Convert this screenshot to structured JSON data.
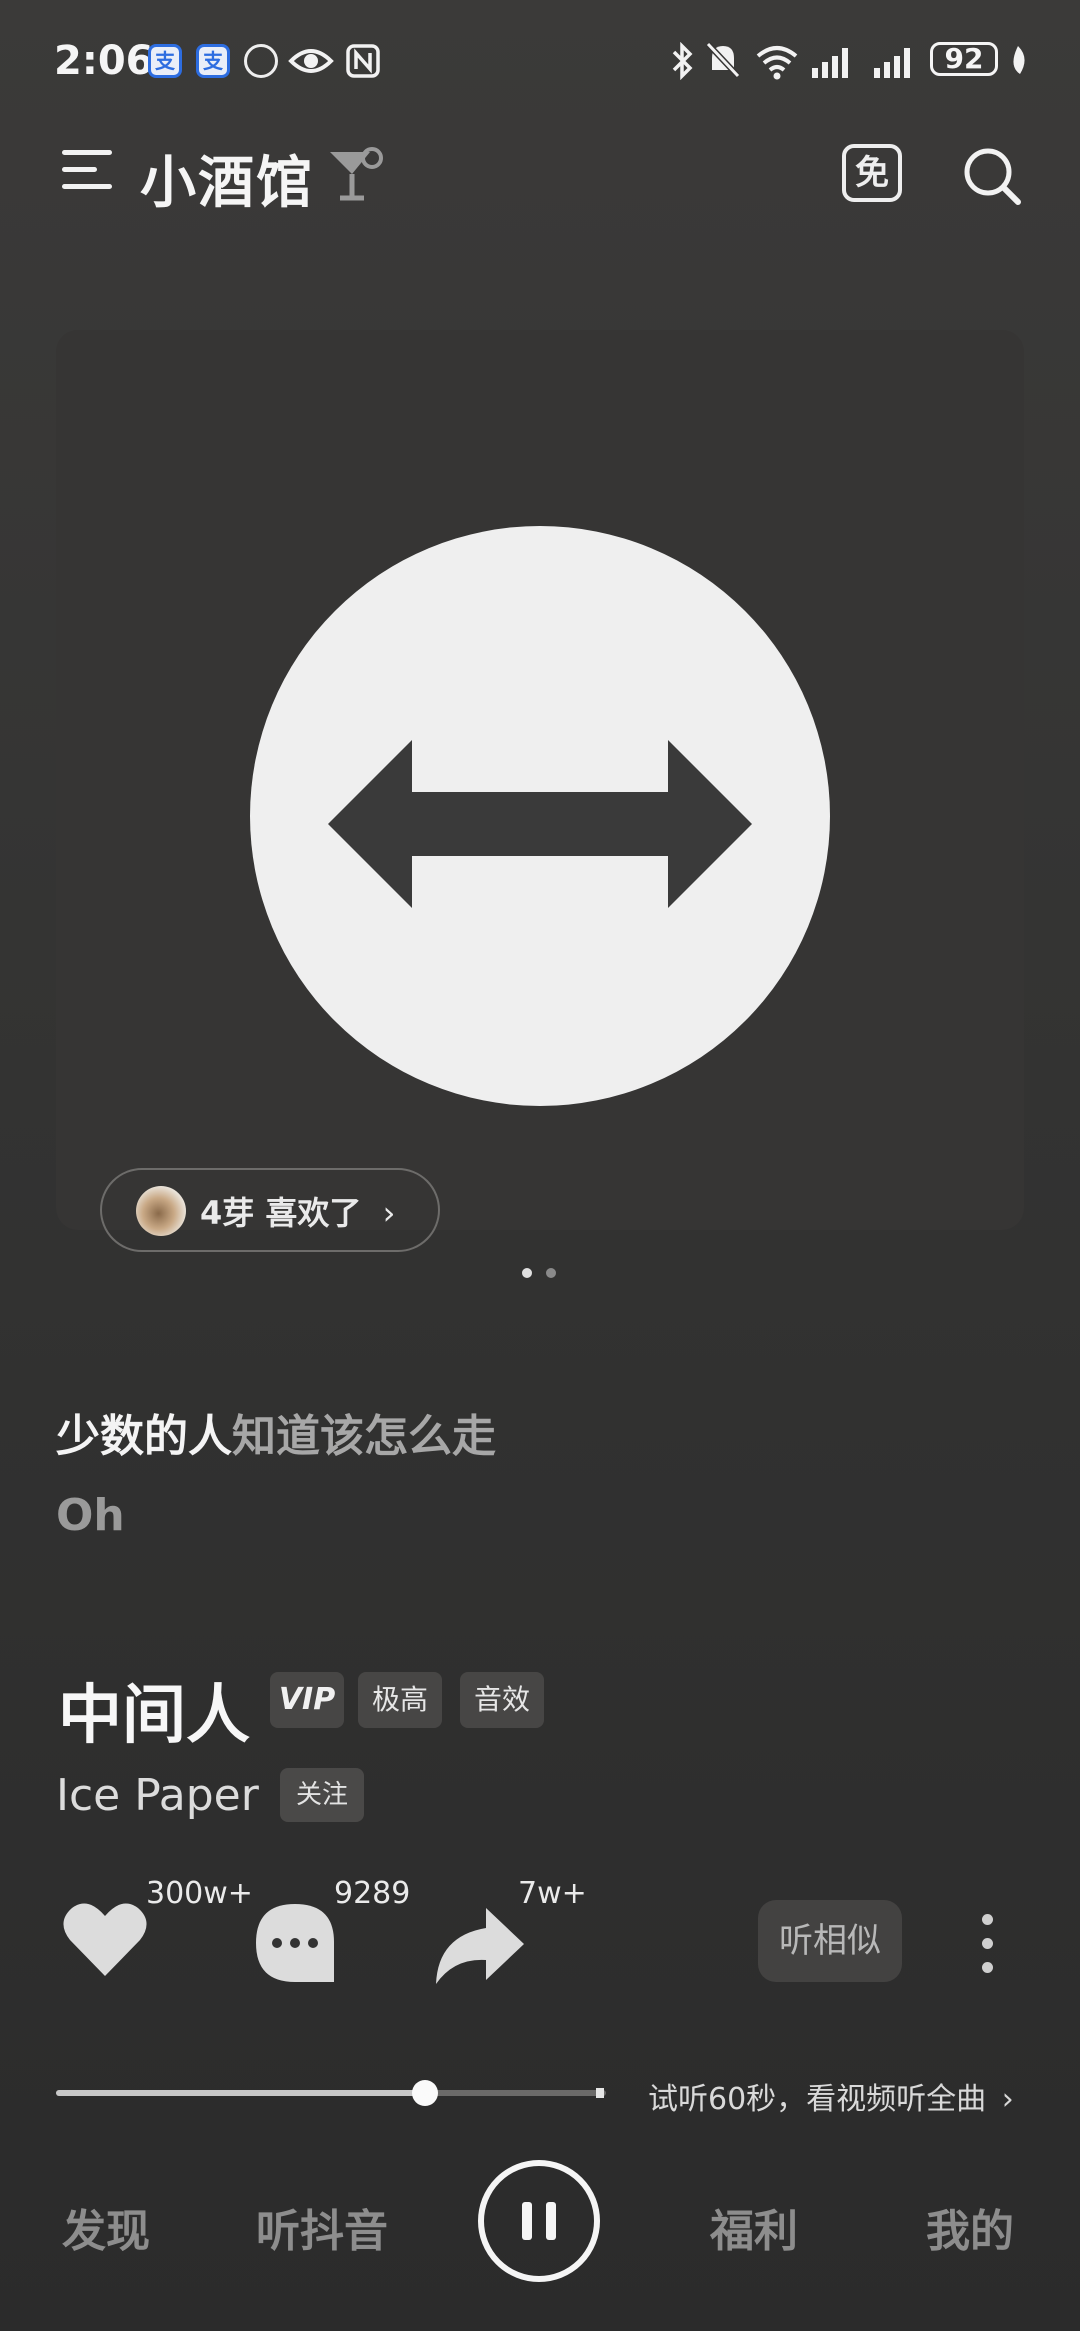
{
  "status_bar": {
    "time": "2:06",
    "battery": "92",
    "icons": [
      "alipay-icon",
      "alipay-icon",
      "app-icon",
      "eye-icon",
      "nfc-icon",
      "bluetooth-icon",
      "mute-icon",
      "wifi-icon",
      "signal-icon",
      "signal-icon",
      "leaf-icon"
    ]
  },
  "header": {
    "brand": "小酒馆",
    "free_badge": "免"
  },
  "cover": {
    "liked_text": "4芽 喜欢了",
    "page_indicator": {
      "count": 2,
      "active": 0
    }
  },
  "lyrics": {
    "line1_highlight": "少数的人",
    "line1_rest": "知道该怎么走",
    "line2": "Oh"
  },
  "song": {
    "title": "中间人",
    "tags": [
      "VIP",
      "极高",
      "音效"
    ],
    "artist": "Ice Paper",
    "follow_label": "关注"
  },
  "actions": {
    "like_count": "300w+",
    "comment_count": "9289",
    "share_count": "7w+",
    "similar_label": "听相似"
  },
  "playback": {
    "progress": 0.67,
    "trial_text": "试听60秒，看视频听全曲"
  },
  "nav": {
    "items": [
      "发现",
      "听抖音",
      "福利",
      "我的"
    ]
  },
  "colors": {
    "background": "#353434",
    "text_primary": "#f2f2f2",
    "text_muted": "#8d8d8d",
    "tag_bg": "#474645"
  }
}
